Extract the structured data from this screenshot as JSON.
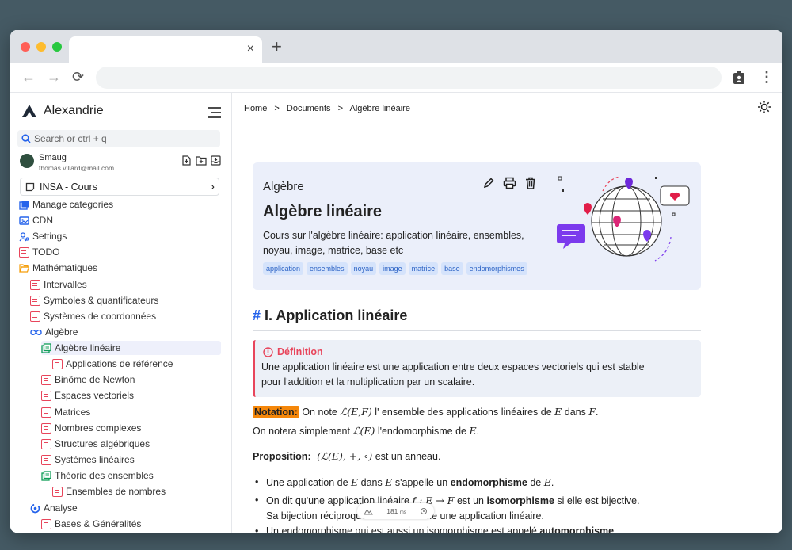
{
  "browser": {
    "tab_close": "×",
    "new_tab": "+",
    "back": "←",
    "forward": "→",
    "reload": "⟳",
    "menu": "⋮"
  },
  "sidebar": {
    "app_name": "Alexandrie",
    "search_placeholder": "Search or ctrl + q",
    "user": {
      "name": "Smaug",
      "email": "thomas.villard@mail.com"
    },
    "vault": "INSA - Cours",
    "items": [
      {
        "label": "Manage categories",
        "icon": "categories-icon",
        "color": "#2563eb"
      },
      {
        "label": "CDN",
        "icon": "cdn-icon",
        "color": "#2563eb"
      },
      {
        "label": "Settings",
        "icon": "settings-icon",
        "color": "#2563eb"
      },
      {
        "label": "TODO",
        "icon": "note-icon",
        "color": "#e8455b"
      },
      {
        "label": "Mathématiques",
        "icon": "folder-open-icon",
        "color": "#f59e0b"
      },
      {
        "label": "Intervalles",
        "icon": "note-icon",
        "color": "#e8455b"
      },
      {
        "label": "Symboles & quantificateurs",
        "icon": "note-icon",
        "color": "#e8455b"
      },
      {
        "label": "Systèmes de coordonnées",
        "icon": "note-icon",
        "color": "#e8455b"
      },
      {
        "label": "Algèbre",
        "icon": "infinity-icon",
        "color": "#2563eb"
      },
      {
        "label": "Algèbre linéaire",
        "icon": "category-icon",
        "color": "#0f9d58"
      },
      {
        "label": "Applications de référence",
        "icon": "note-icon",
        "color": "#e8455b"
      },
      {
        "label": "Binôme de Newton",
        "icon": "note-icon",
        "color": "#e8455b"
      },
      {
        "label": "Espaces vectoriels",
        "icon": "note-icon",
        "color": "#e8455b"
      },
      {
        "label": "Matrices",
        "icon": "note-icon",
        "color": "#e8455b"
      },
      {
        "label": "Nombres complexes",
        "icon": "note-icon",
        "color": "#e8455b"
      },
      {
        "label": "Structures algébriques",
        "icon": "note-icon",
        "color": "#e8455b"
      },
      {
        "label": "Systèmes linéaires",
        "icon": "note-icon",
        "color": "#e8455b"
      },
      {
        "label": "Théorie des ensembles",
        "icon": "category-icon",
        "color": "#0f9d58"
      },
      {
        "label": "Ensembles de nombres",
        "icon": "note-icon",
        "color": "#e8455b"
      },
      {
        "label": "Analyse",
        "icon": "analysis-icon",
        "color": "#2563eb"
      },
      {
        "label": "Bases & Généralités",
        "icon": "note-icon",
        "color": "#e8455b"
      }
    ]
  },
  "breadcrumb": {
    "home": "Home",
    "sep": ">",
    "documents": "Documents",
    "current": "Algèbre linéaire"
  },
  "hero": {
    "category": "Algèbre",
    "title": "Algèbre linéaire",
    "description_line1": "Cours sur l'algèbre linéaire: application linéaire, ensembles,",
    "description_line2": "noyau, image, matrice, base etc",
    "tags": [
      "application",
      "ensembles",
      "noyau",
      "image",
      "matrice",
      "base",
      "endomorphismes"
    ]
  },
  "content": {
    "h1_hash": "#",
    "h1": "I. Application linéaire",
    "definition": {
      "title": "Définition",
      "line1": "Une application linéaire est une application entre deux espaces vectoriels qui est stable",
      "line2": "pour l'addition et la multiplication par un scalaire."
    },
    "notation": {
      "label": "Notation:",
      "t1": " On note ",
      "m1": "ℒ(E,F)",
      "t2": " l' ensemble des applications linéaires de ",
      "m2": "E",
      "t3": " dans ",
      "m3": "F",
      "t4": ".",
      "l2a": "On notera simplement ",
      "l2m": "ℒ(E)",
      "l2b": " l'endomorphisme de ",
      "l2m2": "E",
      "l2c": "."
    },
    "proposition": {
      "label": "Proposition:",
      "math": "(ℒ(E), +, ∘)",
      "text": " est un anneau."
    },
    "bullets": {
      "b1a": "Une application de ",
      "b1m1": "E",
      "b1b": " dans ",
      "b1m2": "E",
      "b1c": " s'appelle un ",
      "b1bold": "endomorphisme",
      "b1d": " de ",
      "b1m3": "E",
      "b1e": ".",
      "b2a": "On dit qu'une application linéaire ",
      "b2m": "f : E → F",
      "b2b": " est un ",
      "b2bold": "isomorphisme",
      "b2c": " si elle est bijective.",
      "b2l2": "Sa bijection réciproque sera elle même une application linéaire.",
      "b3a": "Un endomorphisme qui est aussi un isomorphisme est appelé ",
      "b3bold": "automorphisme",
      "b3b": "."
    },
    "footer_ms": "181",
    "footer_unit": "ms"
  }
}
